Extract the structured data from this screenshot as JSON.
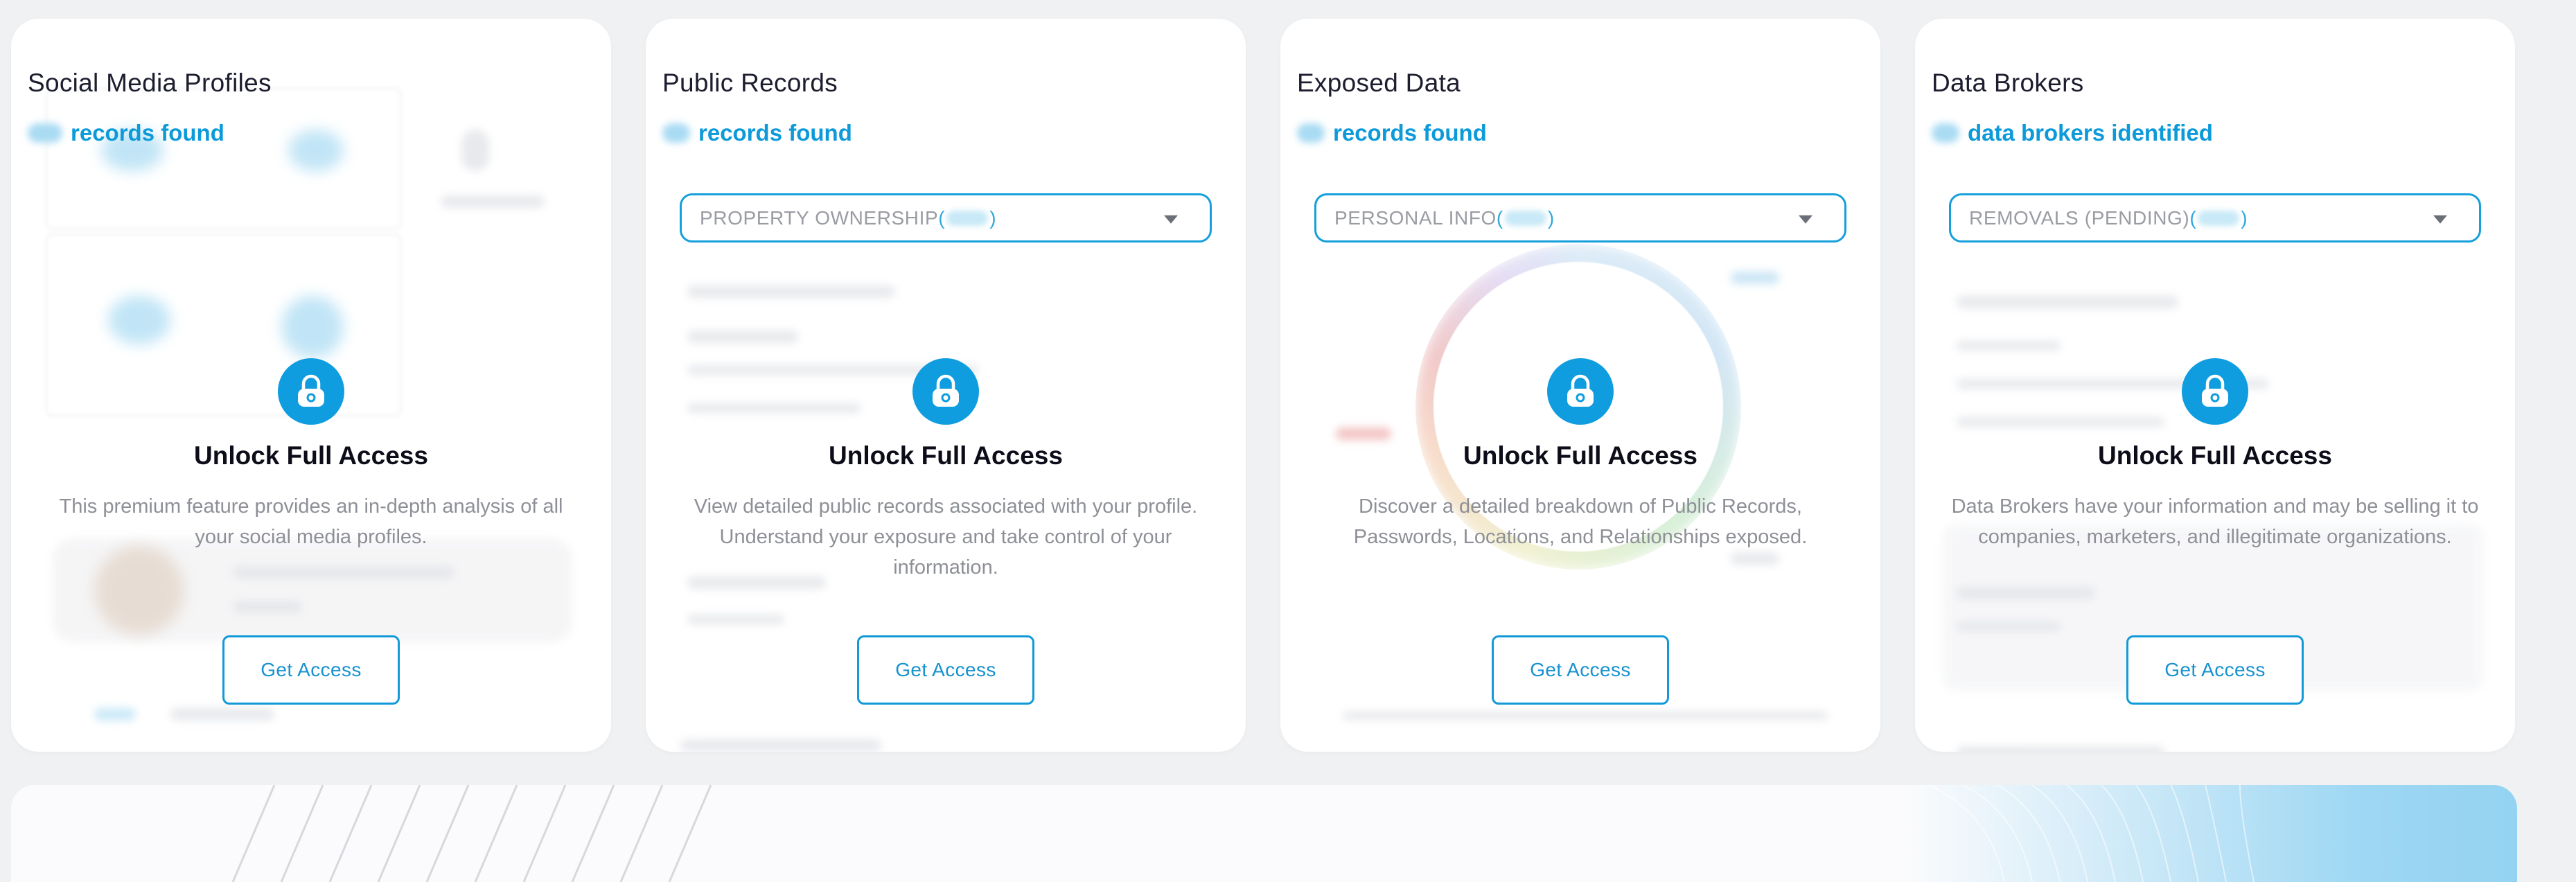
{
  "cards": [
    {
      "title": "Social Media Profiles",
      "subtitle": "records found",
      "unlock_title": "Unlock Full Access",
      "description": "This premium feature provides an in-depth analysis of all your social media profiles.",
      "button": "Get Access",
      "icon": "lock-icon"
    },
    {
      "title": "Public Records",
      "subtitle": "records found",
      "dropdown": {
        "label": "PROPERTY OWNERSHIP",
        "open_paren": "(",
        "close_paren": ")"
      },
      "unlock_title": "Unlock Full Access",
      "description": "View detailed public records associated with your profile. Understand your exposure and take control of your information.",
      "button": "Get Access",
      "icon": "lock-icon"
    },
    {
      "title": "Exposed Data",
      "subtitle": "records found",
      "dropdown": {
        "label": "PERSONAL INFO",
        "open_paren": "(",
        "close_paren": ")"
      },
      "unlock_title": "Unlock Full Access",
      "description": "Discover a detailed breakdown of Public Records, Passwords, Locations, and Relationships exposed.",
      "button": "Get Access",
      "icon": "lock-icon"
    },
    {
      "title": "Data Brokers",
      "subtitle": "data brokers identified",
      "dropdown": {
        "label": "REMOVALS (PENDING)",
        "open_paren": "(",
        "close_paren": ")"
      },
      "unlock_title": "Unlock Full Access",
      "description": "Data Brokers have your information and may be selling it to companies, marketers, and illegitimate organizations.",
      "button": "Get Access",
      "icon": "lock-icon"
    }
  ],
  "colors": {
    "accent": "#0f9ddf",
    "link": "#0d9ad9",
    "background": "#f0f1f3",
    "card": "#ffffff"
  }
}
